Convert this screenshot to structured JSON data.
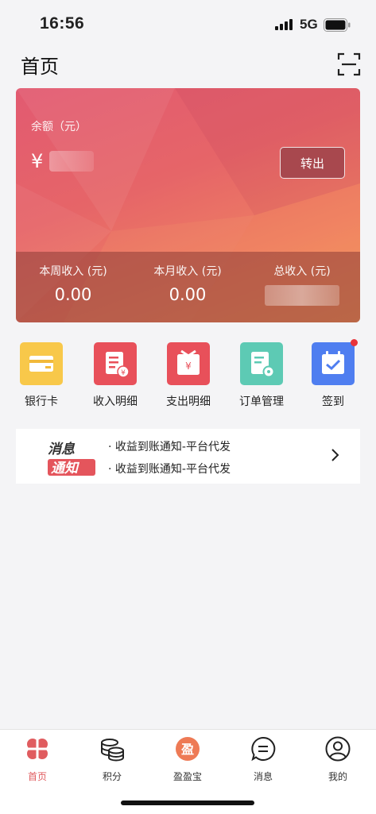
{
  "status_bar": {
    "time": "16:56",
    "network": "5G"
  },
  "header": {
    "title": "首页",
    "scan_icon": "scan-icon"
  },
  "balance_card": {
    "label": "余额（元）",
    "currency": "¥",
    "transfer_label": "转出",
    "income": [
      {
        "label": "本周收入 (元)",
        "value": "0.00"
      },
      {
        "label": "本月收入 (元)",
        "value": "0.00"
      },
      {
        "label": "总收入 (元)",
        "value": ""
      }
    ],
    "colors": {
      "top": "#e25a71",
      "bottom": "#f29a5c",
      "strip": "#8c3c37"
    }
  },
  "shortcuts": [
    {
      "label": "银行卡",
      "icon": "bank-card-icon",
      "color": "#f8c84a"
    },
    {
      "label": "收入明细",
      "icon": "income-detail-icon",
      "color": "#e8505a"
    },
    {
      "label": "支出明细",
      "icon": "expense-detail-icon",
      "color": "#e8505a"
    },
    {
      "label": "订单管理",
      "icon": "order-manage-icon",
      "color": "#5dcab4"
    },
    {
      "label": "签到",
      "icon": "checkin-icon",
      "color": "#4f7ef0"
    }
  ],
  "notice": {
    "logo_line1": "消息",
    "logo_line2": "通知",
    "items": [
      "· 收益到账通知-平台代发",
      "· 收益到账通知-平台代发"
    ]
  },
  "tabbar": [
    {
      "label": "首页",
      "icon": "clover-icon",
      "active": true
    },
    {
      "label": "积分",
      "icon": "coins-icon",
      "active": false
    },
    {
      "label": "盈盈宝",
      "icon": "yingyingbao-icon",
      "active": false
    },
    {
      "label": "消息",
      "icon": "message-icon",
      "active": false
    },
    {
      "label": "我的",
      "icon": "profile-icon",
      "active": false
    }
  ],
  "accent": "#e05c5f"
}
